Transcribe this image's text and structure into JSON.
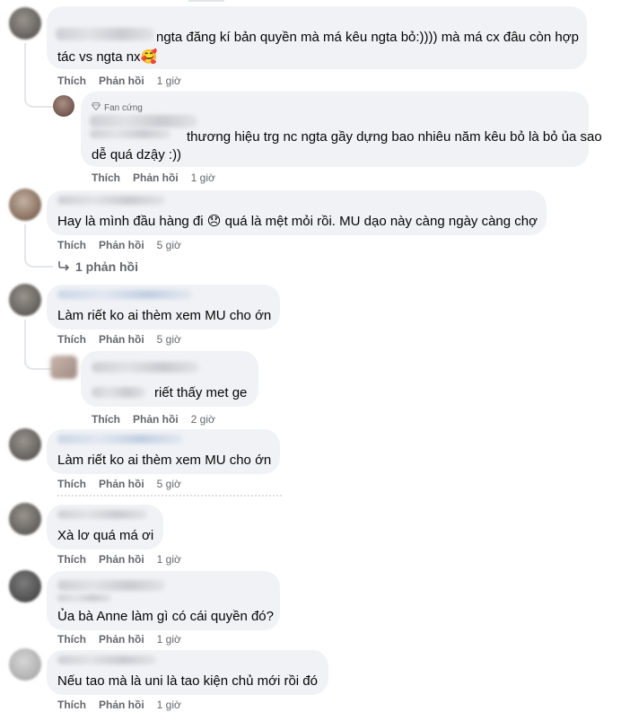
{
  "actions": {
    "like": "Thích",
    "reply": "Phản hồi"
  },
  "comments": [
    {
      "line1": "ngta đăng kí bản quyền mà má kêu ngta bỏ:)))) mà má cx đâu còn hợp",
      "line2": "tác vs ngta nx",
      "emoji": "🥰",
      "time": "1 giờ"
    },
    {
      "badge": "Fan cứng",
      "line1": "thương hiệu trg nc ngta gầy dựng bao nhiêu năm kêu bỏ là bỏ ủa sao",
      "line2": "dễ quá dzậy :))",
      "time": "1 giờ"
    },
    {
      "text": "Hay là mình đầu hàng đi",
      "emoji": "😞",
      "text2": "quá là mệt mỏi rồi. MU dạo này càng ngày càng chợ",
      "time": "5 giờ"
    },
    {
      "text": "Làm riết ko ai thèm xem MU cho ớn",
      "time": "5 giờ"
    },
    {
      "text": "riết thấy met ge",
      "time": "2 giờ"
    },
    {
      "text": "Làm riết ko ai thèm xem MU cho ớn",
      "time": "5 giờ"
    },
    {
      "text": "Xà lơ quá má ơi",
      "time": "1 giờ"
    },
    {
      "text": "Ủa bà Anne làm gì có cái quyền đó?",
      "time": "1 giờ"
    },
    {
      "text": "Nếu tao mà là uni là tao kiện chủ mới rồi đó",
      "time": "1 giờ"
    }
  ],
  "replies_link": {
    "icon": "reply-arrow-icon",
    "label": "1 phản hồi"
  }
}
